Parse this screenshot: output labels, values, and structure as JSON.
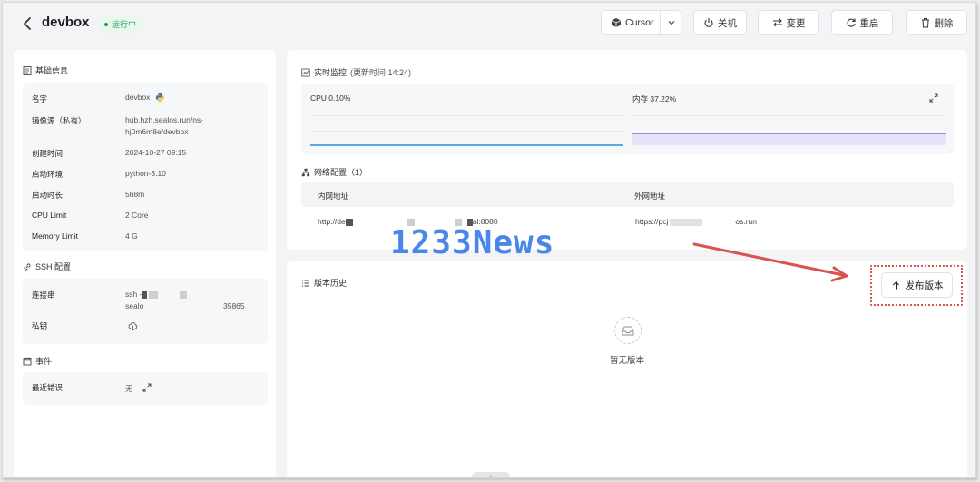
{
  "header": {
    "title": "devbox",
    "status": "运行中",
    "ide_label": "Cursor",
    "actions": {
      "off": "关机",
      "change": "变更",
      "restart": "重启",
      "delete": "删除"
    }
  },
  "basic_info": {
    "title": "基础信息",
    "rows": [
      {
        "label": "名字",
        "value": "devbox"
      },
      {
        "label": "镜像源（私有）",
        "value_line1": "hub.hzh.sealos.run/ns-",
        "value_line2": "hj0m6m8e/devbox"
      },
      {
        "label": "创建时间",
        "value": "2024-10-27 09:15"
      },
      {
        "label": "启动环境",
        "value": "python-3.10"
      },
      {
        "label": "启动时长",
        "value": "5h8m"
      },
      {
        "label": "CPU Limit",
        "value": "2 Core"
      },
      {
        "label": "Memory Limit",
        "value": "4 G"
      }
    ]
  },
  "ssh": {
    "title": "SSH 配置",
    "conn_label": "连接串",
    "conn_prefix": "ssh -",
    "conn_line2": "sealo",
    "conn_port": "35865",
    "key_label": "私钥"
  },
  "events": {
    "title": "事件",
    "recent_error_label": "最近错误",
    "recent_error_value": "无"
  },
  "monitor": {
    "title": "实时监控",
    "update_label": "(更新时间  14:24)",
    "cpu_label": "CPU 0.10%",
    "mem_label": "内存 37.22%",
    "cpu_color": "#4ea4e0",
    "mem_color": "#8e7ce8"
  },
  "network": {
    "title": "网络配置（1）",
    "col_internal": "内网地址",
    "col_external": "外网地址",
    "internal_prefix": "http://de",
    "internal_suffix": "al:8080",
    "external_prefix": "https://pcj",
    "external_suffix": "os.run"
  },
  "history": {
    "title": "版本历史",
    "publish_label": "发布版本",
    "empty_text": "暂无版本"
  },
  "watermark": "1233News",
  "colors": {
    "accent_status": "#1f9d55",
    "annotation_red": "#d9534f",
    "watermark": "#3b7de8"
  }
}
